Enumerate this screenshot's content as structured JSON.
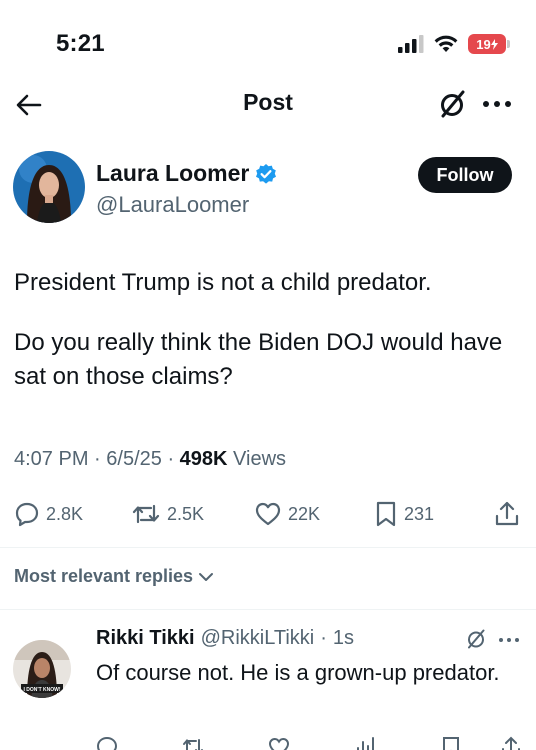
{
  "status_bar": {
    "time": "5:21",
    "battery": "19"
  },
  "nav": {
    "title": "Post"
  },
  "post": {
    "author_name": "Laura Loomer",
    "author_handle": "@LauraLoomer",
    "follow_label": "Follow",
    "paragraphs": [
      "President Trump is not a child predator.",
      "Do you really think the Biden DOJ would have sat on those claims?"
    ],
    "time": "4:07 PM",
    "date": "6/5/25",
    "views_count": "498K",
    "views_label": "Views",
    "replies": "2.8K",
    "reposts": "2.5K",
    "likes": "22K",
    "bookmarks": "231"
  },
  "replies_filter": {
    "label": "Most relevant replies"
  },
  "reply": {
    "name": "Rikki Tikki",
    "handle": "@RikkiLTikki",
    "time": "1s",
    "avatar_caption": "I DON'T KNOW!",
    "text": "Of course not.  He is a grown-up predator."
  },
  "colors": {
    "text": "#0f1419",
    "secondary": "#536471",
    "verified": "#1d9bf0",
    "battery": "#e5484d"
  }
}
